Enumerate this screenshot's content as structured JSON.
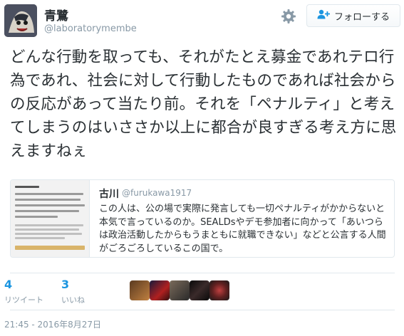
{
  "tweet": {
    "display_name": "青鷺",
    "screen_name": "@laboratorymembe",
    "follow_label": "フォローする",
    "text": "どんな行動を取っても、それがたとえ募金であれテロ行為であれ、社会に対して行動したものであれば社会からの反応があって当たり前。それを「ペナルティ」と考えてしまうのはいささか以上に都合が良すぎる考え方に思えますねぇ",
    "timestamp": "21:45 - 2016年8月27日"
  },
  "quoted_tweet": {
    "display_name": "古川",
    "screen_name": "@furukawa1917",
    "text": "この人は、公の場で実際に発言しても一切ペナルティがかからないと本気で言っているのか。SEALDsやデモ参加者に向かって「あいつらは政治活動したからもうまともに就職できない」などと公言する人間がごろごろしているこの国で。"
  },
  "stats": {
    "retweets": {
      "count": "4",
      "label": "リツイート"
    },
    "likes": {
      "count": "3",
      "label": "いいね"
    }
  },
  "icons": {
    "settings": "gear-icon",
    "follow": "follow-user-icon"
  },
  "colors": {
    "link_blue": "#1b95e0",
    "muted_gray": "#8899a6",
    "border": "#e1e8ed"
  }
}
